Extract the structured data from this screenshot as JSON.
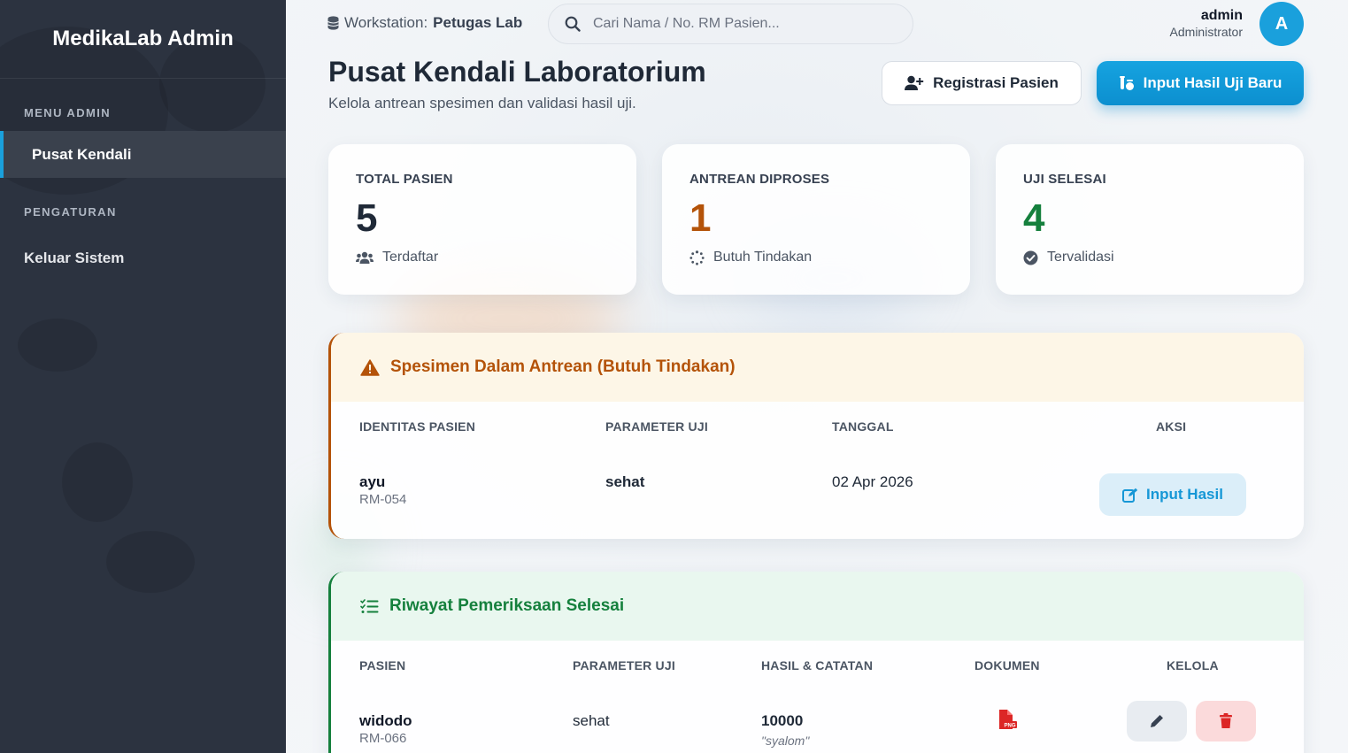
{
  "sidebar": {
    "brand": "MedikaLab Admin",
    "section_menu": "MENU ADMIN",
    "item_dashboard": "Pusat Kendali",
    "section_settings": "PENGATURAN",
    "item_logout": "Keluar Sistem"
  },
  "topbar": {
    "workstation_label": "Workstation:",
    "workstation_value": "Petugas Lab",
    "search_placeholder": "Cari Nama / No. RM Pasien...",
    "user_name": "admin",
    "user_role": "Administrator",
    "avatar_initial": "A"
  },
  "header": {
    "title": "Pusat Kendali Laboratorium",
    "subtitle": "Kelola antrean spesimen dan validasi hasil uji.",
    "btn_register": "Registrasi Pasien",
    "btn_new_result": "Input Hasil Uji Baru"
  },
  "stats": [
    {
      "label": "TOTAL PASIEN",
      "value": "5",
      "note": "Terdaftar",
      "color": "#1f2937",
      "icon": "users-icon"
    },
    {
      "label": "ANTREAN DIPROSES",
      "value": "1",
      "note": "Butuh Tindakan",
      "color": "#b45309",
      "icon": "spinner-icon"
    },
    {
      "label": "UJI SELESAI",
      "value": "4",
      "note": "Tervalidasi",
      "color": "#15803d",
      "icon": "check-circle-icon"
    }
  ],
  "queue": {
    "title": "Spesimen Dalam Antrean (Butuh Tindakan)",
    "accent": "#b45309",
    "columns": [
      "IDENTITAS PASIEN",
      "PARAMETER UJI",
      "TANGGAL",
      "AKSI"
    ],
    "rows": [
      {
        "name": "ayu",
        "rm": "RM-054",
        "param": "sehat",
        "date": "02 Apr 2026",
        "action": "Input Hasil"
      }
    ]
  },
  "history": {
    "title": "Riwayat Pemeriksaan Selesai",
    "accent": "#15803d",
    "columns": [
      "PASIEN",
      "PARAMETER UJI",
      "HASIL & CATATAN",
      "DOKUMEN",
      "KELOLA"
    ],
    "rows": [
      {
        "name": "widodo",
        "rm": "RM-066",
        "param": "sehat",
        "result": "10000",
        "note": "\"syalom\"",
        "doc_icon": "png-file-icon"
      }
    ]
  }
}
